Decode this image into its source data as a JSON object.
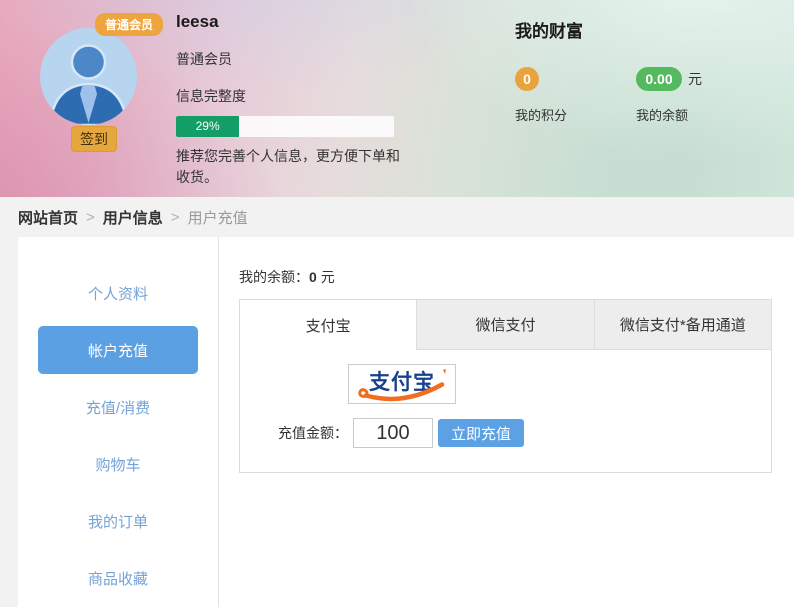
{
  "header": {
    "badge": "普通会员",
    "username": "leesa",
    "member_level": "普通会员",
    "completeness_label": "信息完整度",
    "completeness_percent": "29%",
    "completeness_value": 29,
    "recommendation": "推荐您完善个人信息，更方便下单和收货。",
    "sign_in_label": "签到",
    "wealth": {
      "title": "我的财富",
      "points_value": "0",
      "points_label": "我的积分",
      "balance_value": "0.00",
      "balance_unit": "元",
      "balance_label": "我的余额"
    }
  },
  "breadcrumb": {
    "separator": ">",
    "items": [
      "网站首页",
      "用户信息",
      "用户充值"
    ]
  },
  "sidebar": {
    "items": [
      {
        "label": "个人资料",
        "active": false
      },
      {
        "label": "帐户充值",
        "active": true
      },
      {
        "label": "充值/消费",
        "active": false
      },
      {
        "label": "购物车",
        "active": false
      },
      {
        "label": "我的订单",
        "active": false
      },
      {
        "label": "商品收藏",
        "active": false
      }
    ]
  },
  "main": {
    "balance_line": {
      "label": "我的余额：",
      "value": "0",
      "unit": "元"
    },
    "tabs": [
      "支付宝",
      "微信支付",
      "微信支付*备用通道"
    ],
    "alipay_logo_text": "支付宝",
    "form": {
      "amount_label": "充值金额：",
      "amount_value": "100",
      "submit_label": "立即充值"
    }
  },
  "colors": {
    "accent_blue": "#5ba0e2",
    "progress_green": "#149e67",
    "points_orange": "#e9a33c",
    "balance_green": "#55b95f",
    "badge_gold": "#efa53f",
    "alipay_blue": "#17418f",
    "alipay_orange": "#f06e1f"
  }
}
